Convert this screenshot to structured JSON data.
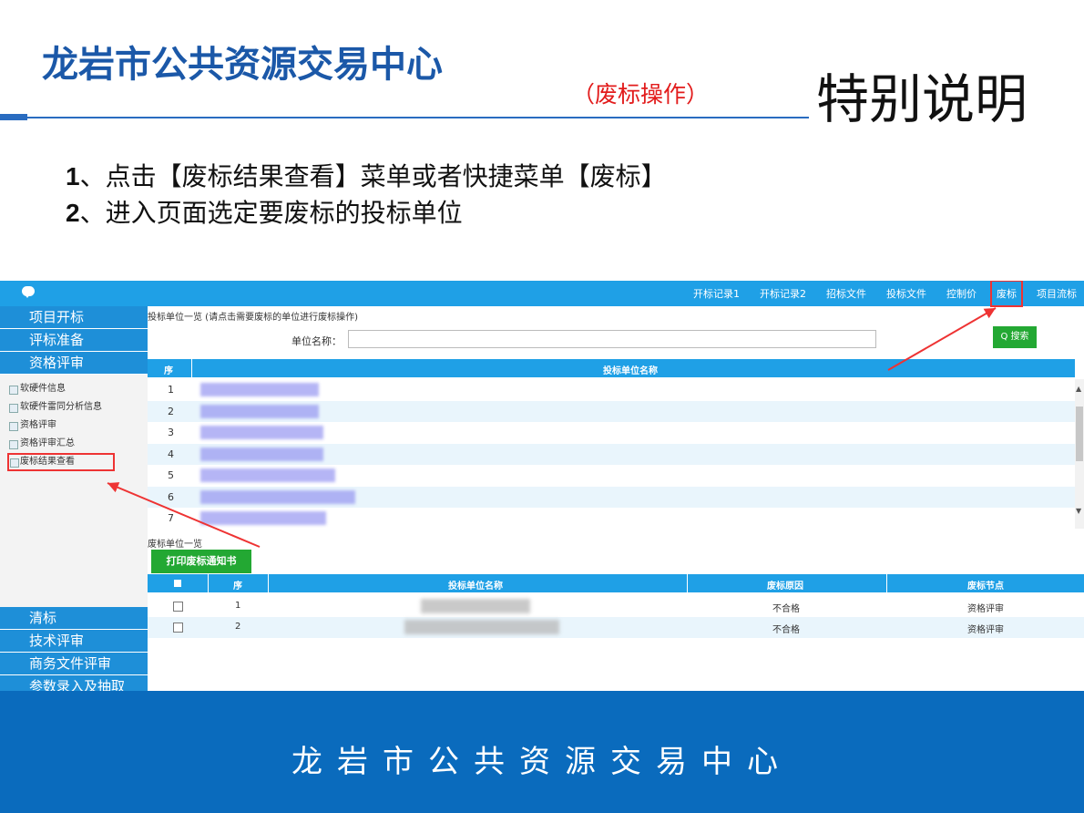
{
  "slide": {
    "title": "龙岩市公共资源交易中心",
    "subtitle": "（废标操作）",
    "special": "特别说明",
    "instructions": [
      {
        "num": "1",
        "text": "、点击【废标结果查看】菜单或者快捷菜单【废标】"
      },
      {
        "num": "2",
        "text": "、进入页面选定要废标的投标单位"
      }
    ],
    "footer": "龙岩市公共资源交易中心"
  },
  "app": {
    "top_nav": [
      "开标记录1",
      "开标记录2",
      "招标文件",
      "投标文件",
      "控制价",
      "废标",
      "项目流标"
    ],
    "highlighted_nav": "废标",
    "sidebar": {
      "headers_top": [
        "项目开标",
        "评标准备",
        "资格评审"
      ],
      "sub_items": [
        "软硬件信息",
        "软硬件雷同分析信息",
        "资格评审",
        "资格评审汇总",
        "废标结果查看"
      ],
      "selected_sub": "废标结果查看",
      "headers_bottom": [
        "清标",
        "技术评审",
        "商务文件评审",
        "参数录入及抽取"
      ]
    },
    "hint": "投标单位一览 (请点击需要废标的单位进行废标操作)",
    "unit_label": "单位名称：",
    "unit_value": "",
    "search_label": "Q 搜索",
    "grid1": {
      "col_seq": "序",
      "col_name": "投标单位名称",
      "rows": [
        "1",
        "2",
        "3",
        "4",
        "5",
        "6",
        "7"
      ]
    },
    "section2_title": "废标单位一览",
    "print_label": "打印废标通知书",
    "grid2": {
      "col_seq": "序",
      "col_name": "投标单位名称",
      "col_reason": "废标原因",
      "col_node": "废标节点",
      "rows": [
        {
          "seq": "1",
          "reason": "不合格",
          "node": "资格评审"
        },
        {
          "seq": "2",
          "reason": "不合格",
          "node": "资格评审"
        }
      ]
    },
    "colors": {
      "header_blue": "#1fa0e6",
      "button_green": "#23a833",
      "highlight_red": "#e33333",
      "footer_blue": "#0a6bbd"
    }
  }
}
